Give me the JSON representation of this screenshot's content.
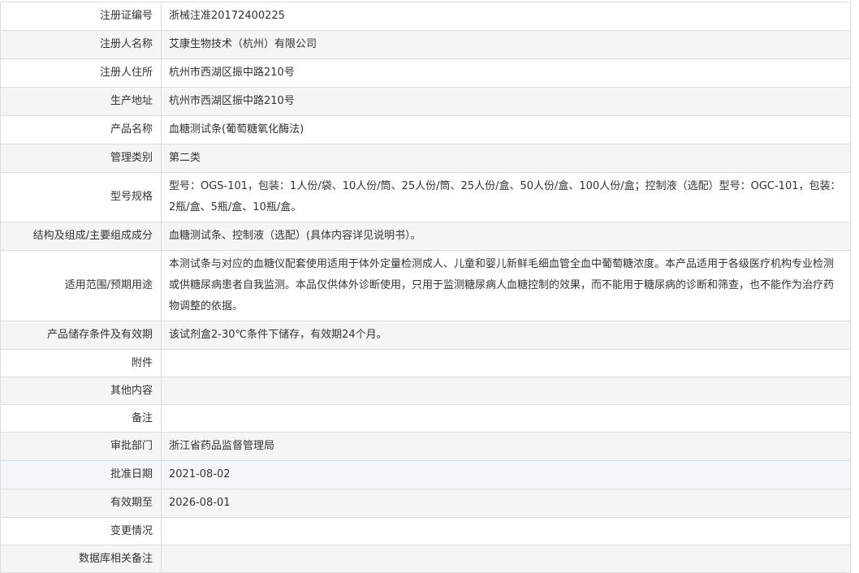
{
  "rows": [
    {
      "label": "注册证编号",
      "value": "浙械注准20172400225"
    },
    {
      "label": "注册人名称",
      "value": "艾康生物技术（杭州）有限公司"
    },
    {
      "label": "注册人住所",
      "value": "杭州市西湖区振中路210号"
    },
    {
      "label": "生产地址",
      "value": "杭州市西湖区振中路210号"
    },
    {
      "label": "产品名称",
      "value": "血糖测试条(葡萄糖氧化酶法)"
    },
    {
      "label": "管理类别",
      "value": "第二类"
    },
    {
      "label": "型号规格",
      "value": "型号：OGS-101，包装：1人份/袋、10人份/筒、25人份/筒、25人份/盒、50人份/盒、100人份/盒；控制液（选配）型号：OGC-101，包装：2瓶/盒、5瓶/盒、10瓶/盒。"
    },
    {
      "label": "结构及组成/主要组成成分",
      "value": "血糖测试条、控制液（选配）(具体内容详见说明书）。"
    },
    {
      "label": "适用范围/预期用途",
      "value": "本测试条与对应的血糖仪配套使用适用于体外定量检测成人、儿童和婴儿新鲜毛细血管全血中葡萄糖浓度。本产品适用于各级医疗机构专业检测或供糖尿病患者自我监测。本品仅供体外诊断使用，只用于监测糖尿病人血糖控制的效果，而不能用于糖尿病的诊断和筛查，也不能作为治疗药物调整的依据。"
    },
    {
      "label": "产品储存条件及有效期",
      "value": "该试剂盒2-30℃条件下储存，有效期24个月。"
    },
    {
      "label": "附件",
      "value": ""
    },
    {
      "label": "其他内容",
      "value": ""
    },
    {
      "label": "备注",
      "value": ""
    },
    {
      "label": "审批部门",
      "value": "浙江省药品监督管理局"
    },
    {
      "label": "批准日期",
      "value": "2021-08-02"
    },
    {
      "label": "有效期至",
      "value": "2026-08-01"
    },
    {
      "label": "变更情况",
      "value": ""
    },
    {
      "label": "数据库相关备注",
      "value": ""
    }
  ]
}
